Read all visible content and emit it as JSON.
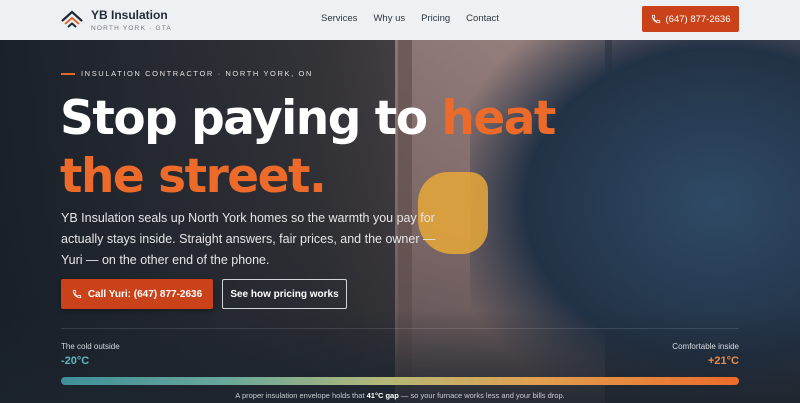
{
  "header": {
    "brand_name": "YB Insulation",
    "brand_sub": "NORTH YORK · GTA",
    "nav": [
      "Services",
      "Why us",
      "Pricing",
      "Contact"
    ],
    "phone_button": "(647) 877-2636"
  },
  "hero": {
    "eyebrow": "INSULATION CONTRACTOR · NORTH YORK, ON",
    "headline_part1": "Stop paying to ",
    "headline_highlight": "heat the street.",
    "lede": "YB Insulation seals up North York homes so the warmth you pay for actually stays inside. Straight answers, fair prices, and the owner — Yuri — on the other end of the phone.",
    "cta_primary": "Call Yuri: (647) 877-2636",
    "cta_secondary": "See how pricing works"
  },
  "temperature": {
    "left_label": "The cold outside",
    "left_value": "-20°C",
    "right_label": "Comfortable inside",
    "right_value": "+21°C",
    "caption_before": "A proper insulation envelope holds that ",
    "caption_bold": "41°C gap",
    "caption_after": " — so your furnace works less and your bills drop."
  },
  "colors": {
    "accent": "#c9421a",
    "highlight": "#ec6b2a",
    "cold": "#5fb6c0",
    "warm": "#f08a4a"
  },
  "icons": {
    "logo": "roof-chevrons-logo",
    "phone": "phone-icon"
  }
}
